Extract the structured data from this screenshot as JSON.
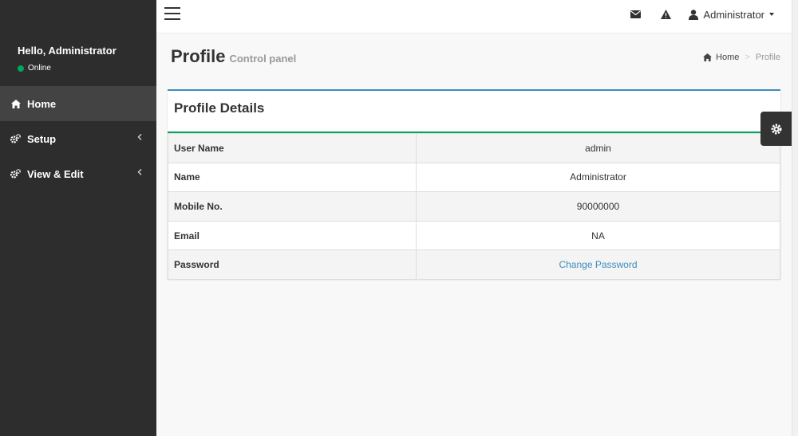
{
  "sidebar": {
    "greeting": "Hello, Administrator",
    "status": "Online",
    "items": [
      {
        "label": "Home",
        "icon": "home-icon"
      },
      {
        "label": "Setup",
        "icon": "cogs-icon"
      },
      {
        "label": "View & Edit",
        "icon": "cogs-icon"
      }
    ]
  },
  "navbar": {
    "user_name": "Administrator",
    "icons": [
      "menu-icon",
      "envelope-icon",
      "warning-icon",
      "user-icon"
    ]
  },
  "header": {
    "title": "Profile",
    "subtitle": "Control panel",
    "breadcrumb": {
      "home": "Home",
      "current": "Profile"
    }
  },
  "box": {
    "title": "Profile Details",
    "rows": [
      {
        "label": "User Name",
        "value": "admin"
      },
      {
        "label": "Name",
        "value": "Administrator"
      },
      {
        "label": "Mobile No.",
        "value": "90000000"
      },
      {
        "label": "Email",
        "value": "NA"
      },
      {
        "label": "Password",
        "value": "Change Password"
      }
    ]
  },
  "colors": {
    "sidebar_bg": "#2d2d2d",
    "active_item": "#434343",
    "online": "#00a65a",
    "box_top": "#3c8dbc",
    "header_divider": "#00a65a",
    "link": "#3c8dbc"
  }
}
